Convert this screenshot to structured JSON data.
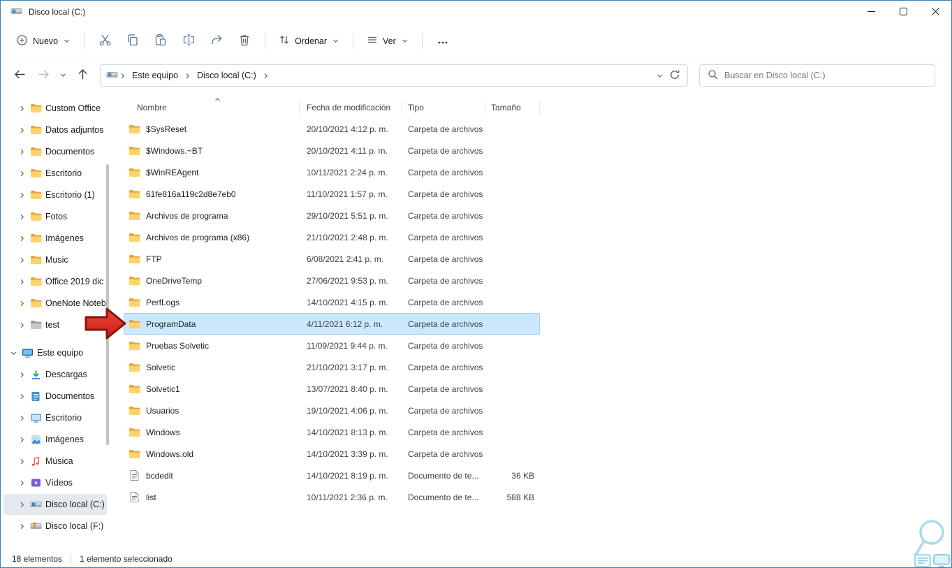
{
  "window": {
    "title": "Disco local (C:)"
  },
  "toolbar": {
    "new_label": "Nuevo",
    "sort_label": "Ordenar",
    "view_label": "Ver"
  },
  "address": {
    "crumbs": [
      "Este equipo",
      "Disco local (C:)"
    ]
  },
  "search": {
    "placeholder": "Buscar en Disco local (C:)"
  },
  "sidebar": {
    "items": [
      {
        "label": "Custom Office",
        "icon": "folder-icon"
      },
      {
        "label": "Datos adjuntos",
        "icon": "folder-icon"
      },
      {
        "label": "Documentos",
        "icon": "folder-icon"
      },
      {
        "label": "Escritorio",
        "icon": "folder-icon"
      },
      {
        "label": "Escritorio (1)",
        "icon": "folder-icon"
      },
      {
        "label": "Fotos",
        "icon": "folder-icon"
      },
      {
        "label": "Imágenes",
        "icon": "folder-icon"
      },
      {
        "label": "Music",
        "icon": "folder-icon"
      },
      {
        "label": "Office 2019 dic",
        "icon": "folder-icon"
      },
      {
        "label": "OneNote Notebl",
        "icon": "folder-icon"
      },
      {
        "label": "test",
        "icon": "folder-gray-icon"
      },
      {
        "label": "Este equipo",
        "icon": "computer-icon",
        "root": true,
        "expanded": true,
        "gap": true
      },
      {
        "label": "Descargas",
        "icon": "download-icon"
      },
      {
        "label": "Documentos",
        "icon": "documents-icon"
      },
      {
        "label": "Escritorio",
        "icon": "desktop-icon"
      },
      {
        "label": "Imágenes",
        "icon": "pictures-icon"
      },
      {
        "label": "Música",
        "icon": "music-icon"
      },
      {
        "label": "Vídeos",
        "icon": "videos-icon"
      },
      {
        "label": "Disco local (C:)",
        "icon": "drive-icon",
        "selected": true
      },
      {
        "label": "Disco local (F:)",
        "icon": "drive-f-icon"
      }
    ]
  },
  "files": {
    "columns": {
      "name": "Nombre",
      "date": "Fecha de modificación",
      "type": "Tipo",
      "size": "Tamaño"
    },
    "rows": [
      {
        "name": "$SysReset",
        "date": "20/10/2021 4:12 p. m.",
        "type": "Carpeta de archivos",
        "size": "",
        "icon": "folder-icon"
      },
      {
        "name": "$Windows.~BT",
        "date": "20/10/2021 4:11 p. m.",
        "type": "Carpeta de archivos",
        "size": "",
        "icon": "folder-icon"
      },
      {
        "name": "$WinREAgent",
        "date": "10/11/2021 2:24 p. m.",
        "type": "Carpeta de archivos",
        "size": "",
        "icon": "folder-icon"
      },
      {
        "name": "61fe816a119c2d8e7eb0",
        "date": "11/10/2021 1:57 p. m.",
        "type": "Carpeta de archivos",
        "size": "",
        "icon": "folder-icon"
      },
      {
        "name": "Archivos de programa",
        "date": "29/10/2021 5:51 p. m.",
        "type": "Carpeta de archivos",
        "size": "",
        "icon": "folder-icon"
      },
      {
        "name": "Archivos de programa (x86)",
        "date": "21/10/2021 2:48 p. m.",
        "type": "Carpeta de archivos",
        "size": "",
        "icon": "folder-icon"
      },
      {
        "name": "FTP",
        "date": "6/08/2021 2:41 p. m.",
        "type": "Carpeta de archivos",
        "size": "",
        "icon": "folder-icon"
      },
      {
        "name": "OneDriveTemp",
        "date": "27/06/2021 9:53 p. m.",
        "type": "Carpeta de archivos",
        "size": "",
        "icon": "folder-icon"
      },
      {
        "name": "PerfLogs",
        "date": "14/10/2021 4:15 p. m.",
        "type": "Carpeta de archivos",
        "size": "",
        "icon": "folder-icon"
      },
      {
        "name": "ProgramData",
        "date": "4/11/2021 6:12 p. m.",
        "type": "Carpeta de archivos",
        "size": "",
        "icon": "folder-icon",
        "selected": true
      },
      {
        "name": "Pruebas Solvetic",
        "date": "11/09/2021 9:44 p. m.",
        "type": "Carpeta de archivos",
        "size": "",
        "icon": "folder-icon"
      },
      {
        "name": "Solvetic",
        "date": "21/10/2021 3:17 p. m.",
        "type": "Carpeta de archivos",
        "size": "",
        "icon": "folder-icon"
      },
      {
        "name": "Solvetic1",
        "date": "13/07/2021 8:40 p. m.",
        "type": "Carpeta de archivos",
        "size": "",
        "icon": "folder-icon"
      },
      {
        "name": "Usuarios",
        "date": "19/10/2021 4:06 p. m.",
        "type": "Carpeta de archivos",
        "size": "",
        "icon": "folder-icon"
      },
      {
        "name": "Windows",
        "date": "14/10/2021 8:13 p. m.",
        "type": "Carpeta de archivos",
        "size": "",
        "icon": "folder-icon"
      },
      {
        "name": "Windows.old",
        "date": "14/10/2021 3:39 p. m.",
        "type": "Carpeta de archivos",
        "size": "",
        "icon": "folder-icon"
      },
      {
        "name": "bcdedit",
        "date": "14/10/2021 8:19 p. m.",
        "type": "Documento de te...",
        "size": "36 KB",
        "icon": "text-doc-icon"
      },
      {
        "name": "list",
        "date": "10/11/2021 2:36 p. m.",
        "type": "Documento de te...",
        "size": "588 KB",
        "icon": "text-doc-icon"
      }
    ]
  },
  "statusbar": {
    "count": "18 elementos",
    "selected": "1 elemento seleccionado"
  },
  "colors": {
    "selection_blue": "#cce8ff",
    "annotation_red": "#e8372c",
    "folder_yellow": "#ffd36b",
    "window_border_blue": "#3c7fb1"
  }
}
